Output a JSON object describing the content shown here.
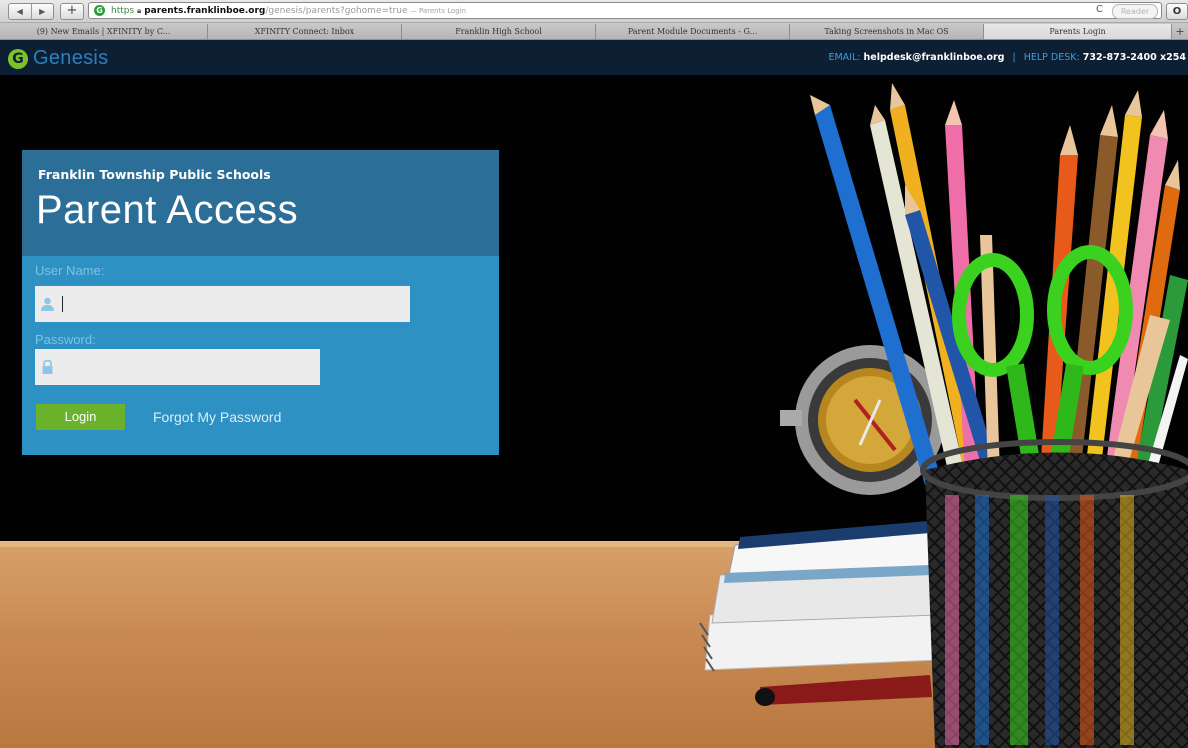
{
  "browser": {
    "back_icon": "back-arrow-icon",
    "forward_icon": "forward-arrow-icon",
    "new_tab_icon": "plus-icon",
    "favicon": "G",
    "url": {
      "scheme": "https",
      "host": "parents.franklinboe.org",
      "path": "/genesis/parents?gohome=true",
      "page_title_suffix": " — Parents Login"
    },
    "reload_glyph": "C",
    "reader_label": "Reader",
    "sidebar_glyph": "O",
    "tabs": [
      {
        "label": "(9) New Emails | XFINITY by C..."
      },
      {
        "label": "XFINITY Connect: Inbox"
      },
      {
        "label": "Franklin High School"
      },
      {
        "label": "Parent Module Documents - G..."
      },
      {
        "label": "Taking Screenshots in Mac OS"
      },
      {
        "label": "Parents Login",
        "active": true
      }
    ]
  },
  "header": {
    "logo_text": "Genesis",
    "logo_glyph": "G",
    "email_label": "EMAIL:",
    "email_value": "helpdesk@franklinboe.org",
    "separator": "|",
    "help_label": "HELP DESK:",
    "help_value": "732-873-2400 x254"
  },
  "login": {
    "district": "Franklin Township Public Schools",
    "portal_title": "Parent Access",
    "username_label": "User Name:",
    "username_value": "",
    "password_label": "Password:",
    "password_value": "",
    "login_label": "Login",
    "forgot_label": "Forgot My Password"
  },
  "colors": {
    "header_bg": "#0c1f33",
    "card_bg": "#2e91c4",
    "card_head_bg": "#2b6f98",
    "login_button": "#6ab12c",
    "logo_green": "#7ec22a",
    "logo_blue": "#2b80c0"
  },
  "background_scene": "school supplies photo: pencil cup, scissors, compass, notebooks on wooden desk"
}
